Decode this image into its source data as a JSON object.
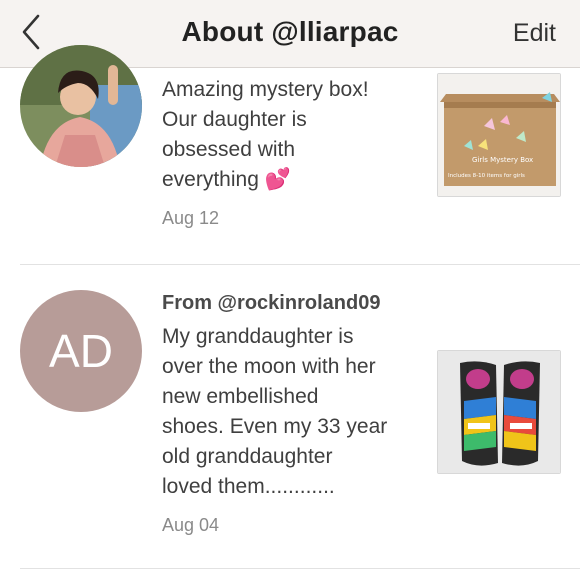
{
  "header": {
    "back_icon": "chevron-left-icon",
    "title": "About @lliarpac",
    "edit_label": "Edit"
  },
  "reviews": [
    {
      "from": "",
      "text_lines": [
        "Amazing mystery box!",
        "Our daughter is",
        "obsessed with",
        "everything 💕"
      ],
      "date": "Aug 12",
      "avatar_type": "photo",
      "thumb_label": "Girls Mystery Box",
      "thumb_sublabel": "Includes 8-10 items for girls"
    },
    {
      "from": "From @rockinroland09",
      "text_lines": [
        "My granddaughter is",
        "over the moon with her",
        "new embellished",
        "shoes. Even my 33 year",
        "old granddaughter",
        "loved them............"
      ],
      "date": "Aug 04",
      "avatar_type": "initials",
      "initials": "AD",
      "avatar_color": "#b79c98"
    }
  ]
}
